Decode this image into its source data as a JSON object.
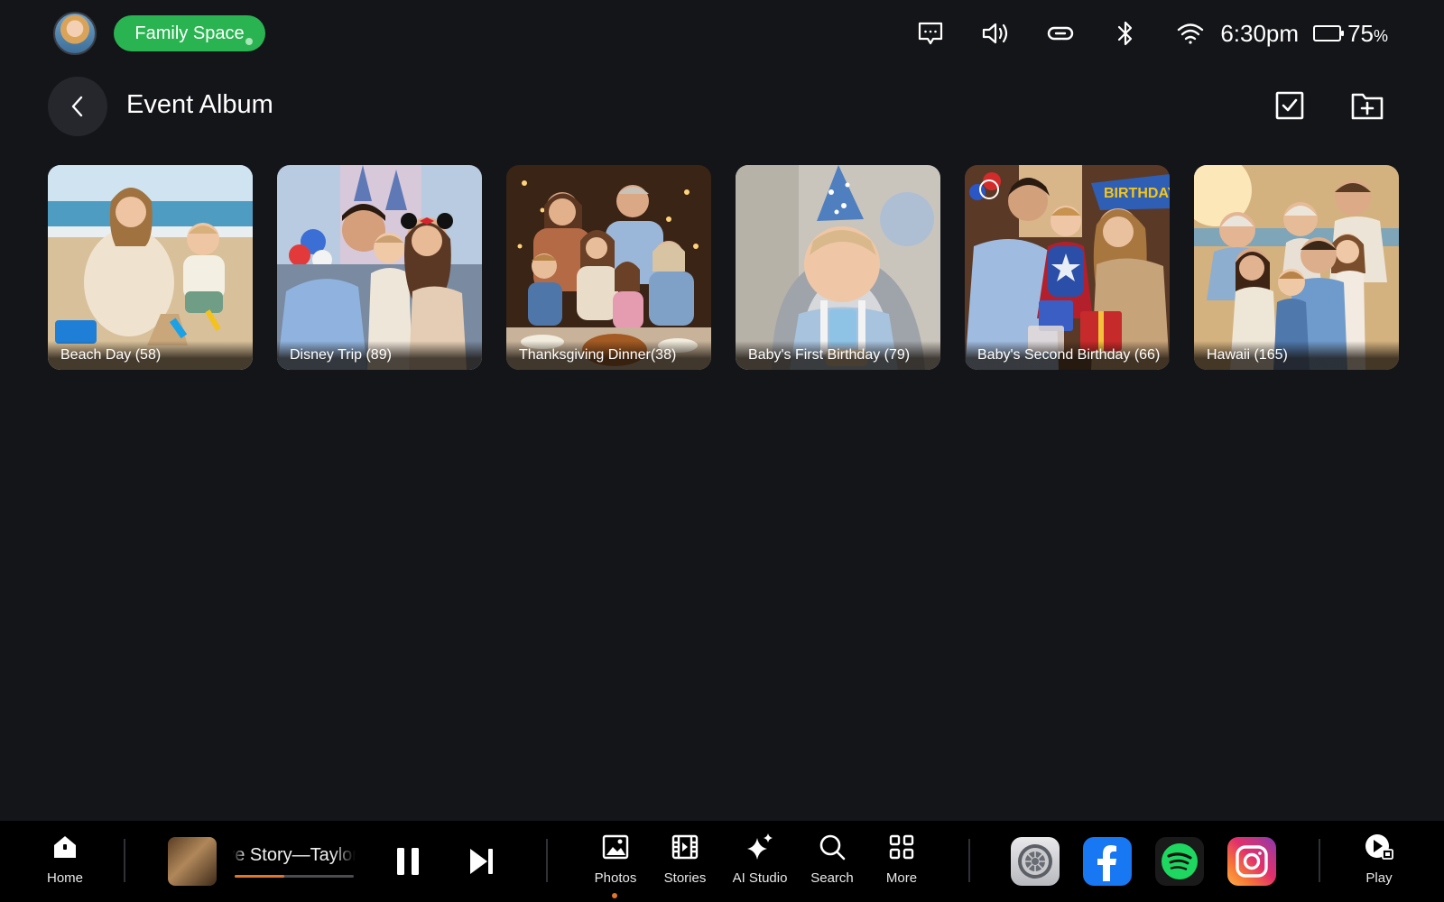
{
  "status_bar": {
    "space_label": "Family Space",
    "time": "6:30pm",
    "battery_value": "75",
    "battery_unit": "%",
    "battery_level": 0.75,
    "icons": [
      "message-icon",
      "volume-icon",
      "link-icon",
      "bluetooth-icon",
      "wifi-icon",
      "battery-icon"
    ]
  },
  "header": {
    "title": "Event Album",
    "actions": [
      "select-checkbox-icon",
      "new-folder-icon"
    ]
  },
  "albums": [
    {
      "label": "Beach Day (58)"
    },
    {
      "label": "Disney Trip (89)"
    },
    {
      "label": "Thanksgiving Dinner(38)"
    },
    {
      "label": "Baby's First Birthday (79)"
    },
    {
      "label": "Baby's Second Birthday (66)"
    },
    {
      "label": "Hawaii (165)"
    }
  ],
  "dock": {
    "home_label": "Home",
    "now_playing": {
      "title": "Love Story—Taylor Swift",
      "progress": 0.42
    },
    "nav": [
      {
        "label": "Photos",
        "icon": "photo-icon",
        "active": true
      },
      {
        "label": "Stories",
        "icon": "film-icon"
      },
      {
        "label": "AI Studio",
        "icon": "sparkle-icon"
      },
      {
        "label": "Search",
        "icon": "search-icon"
      },
      {
        "label": "More",
        "icon": "grid-icon"
      }
    ],
    "apps": [
      "settings-app-icon",
      "facebook-app-icon",
      "spotify-app-icon",
      "instagram-app-icon"
    ],
    "play_label": "Play"
  },
  "colors": {
    "background": "#141519",
    "accent_green": "#2ab451",
    "accent_orange": "#e0752b",
    "dock": "#000000"
  }
}
